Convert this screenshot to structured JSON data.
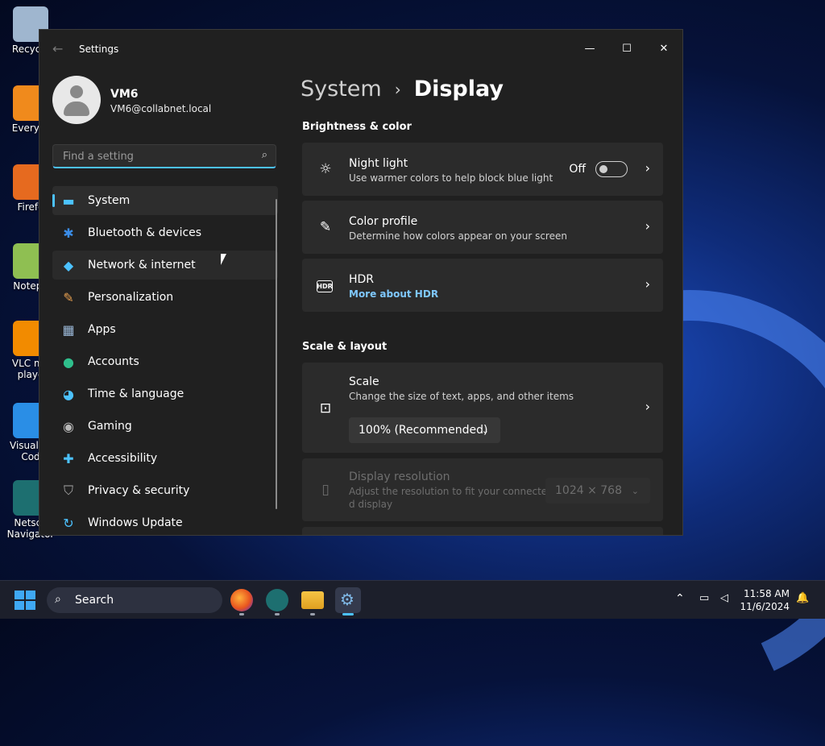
{
  "desktop": {
    "icons": [
      {
        "label": "Recycle",
        "color": "#9fb6cf"
      },
      {
        "label": "Everyth",
        "color": "#f08a1c"
      },
      {
        "label": "Firefo",
        "color": "#e66a1f"
      },
      {
        "label": "Notepa",
        "color": "#8fbf52"
      },
      {
        "label": "VLC me playe",
        "color": "#f28b00"
      },
      {
        "label": "Visual St Cod",
        "color": "#2a8ee6"
      },
      {
        "label": "Netsca Navigator",
        "color": "#1d6f70"
      }
    ]
  },
  "window": {
    "title": "Settings",
    "back_icon": "back-arrow-icon",
    "minimize": "—",
    "maximize": "☐",
    "close": "✕"
  },
  "user": {
    "name": "VM6",
    "email": "VM6@collabnet.local"
  },
  "search": {
    "placeholder": "Find a setting",
    "icon": "⌕"
  },
  "nav": {
    "items": [
      {
        "label": "System",
        "icon": "▬",
        "color": "#4cc2ff"
      },
      {
        "label": "Bluetooth & devices",
        "icon": "✱",
        "color": "#3b8de8"
      },
      {
        "label": "Network & internet",
        "icon": "◆",
        "color": "#4cc2ff"
      },
      {
        "label": "Personalization",
        "icon": "✎",
        "color": "#e8a050"
      },
      {
        "label": "Apps",
        "icon": "▦",
        "color": "#9bb8d8"
      },
      {
        "label": "Accounts",
        "icon": "●",
        "color": "#2fbf8c"
      },
      {
        "label": "Time & language",
        "icon": "◕",
        "color": "#4cc2ff"
      },
      {
        "label": "Gaming",
        "icon": "◉",
        "color": "#b8b8b8"
      },
      {
        "label": "Accessibility",
        "icon": "✚",
        "color": "#4cc2ff"
      },
      {
        "label": "Privacy & security",
        "icon": "⛉",
        "color": "#a8a8a8"
      },
      {
        "label": "Windows Update",
        "icon": "↻",
        "color": "#4cc2ff"
      }
    ]
  },
  "breadcrumb": {
    "parent": "System",
    "separator": "›",
    "current": "Display"
  },
  "sections": {
    "brightness": {
      "heading": "Brightness & color",
      "night_light": {
        "title": "Night light",
        "desc": "Use warmer colors to help block blue light",
        "state": "Off",
        "icon": "☼",
        "chevron": "›"
      },
      "color_profile": {
        "title": "Color profile",
        "desc": "Determine how colors appear on your screen",
        "icon": "✎",
        "chevron": "›"
      },
      "hdr": {
        "title": "HDR",
        "link": "More about HDR",
        "icon": "HDR",
        "chevron": "›"
      }
    },
    "scale_layout": {
      "heading": "Scale & layout",
      "scale": {
        "title": "Scale",
        "desc": "Change the size of text, apps, and other items",
        "value": "100% (Recommended)",
        "icon": "⊡",
        "chevron": "›",
        "dd_chev": "⌄"
      },
      "resolution": {
        "title": "Display resolution",
        "desc_line1": "Adjust the resolution to fit your connecte",
        "desc_line2": "d display",
        "value": "1024 × 768",
        "icon": "▯",
        "dd_chev": "⌄"
      }
    }
  },
  "taskbar": {
    "search_label": "Search",
    "search_icon": "⌕",
    "tray_chevron": "⌃",
    "time": "11:58 AM",
    "date": "11/6/2024",
    "notification_icon": "🔔",
    "accent": "#4cc2ff"
  }
}
